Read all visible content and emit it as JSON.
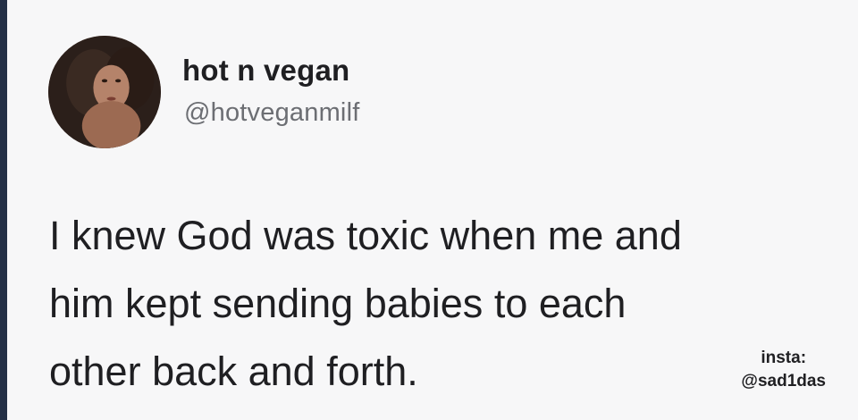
{
  "tweet": {
    "avatar_icon": "profile-photo-icon",
    "display_name": "hot n vegan",
    "handle": "@hotveganmilf",
    "text_lines": [
      "I knew God was toxic when me and",
      "him kept sending babies to each",
      "other back and forth."
    ]
  },
  "watermark": {
    "line1": "insta:",
    "line2": "@sad1das"
  },
  "colors": {
    "card_background": "#f7f7f8",
    "text_primary": "#1f1f22",
    "text_secondary": "#6c6e73",
    "edge": "#243046"
  }
}
